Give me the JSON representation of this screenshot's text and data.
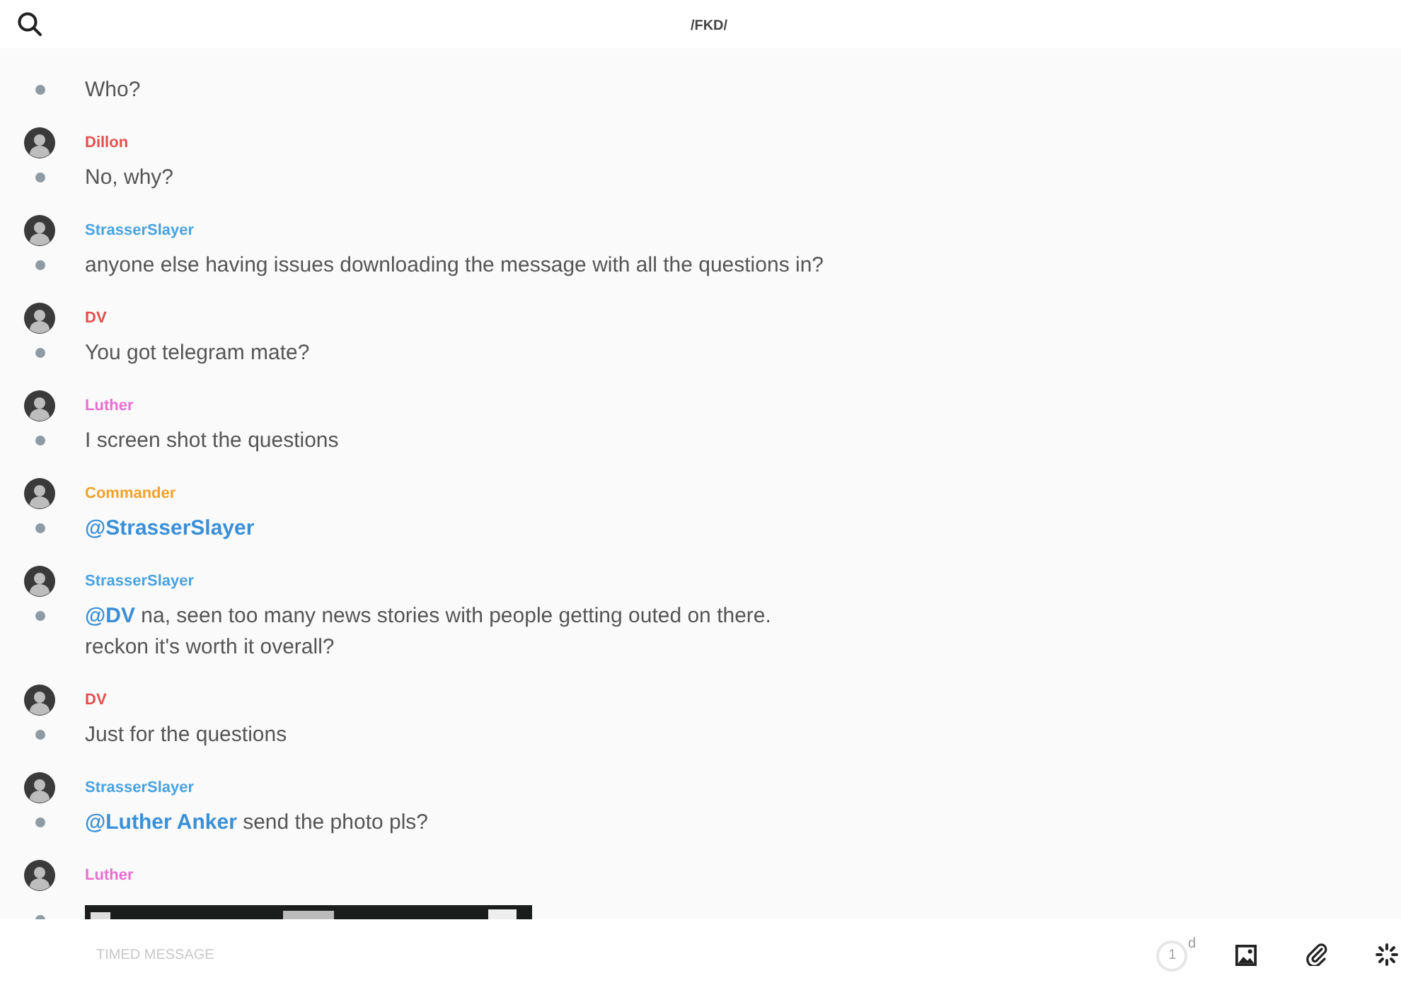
{
  "header": {
    "title": "/FKD/"
  },
  "messages": [
    {
      "lines": [
        {
          "text": "Who?"
        }
      ]
    },
    {
      "author": "Dillon",
      "color": "#e2504c",
      "lines": [
        {
          "text": "No, why?"
        }
      ]
    },
    {
      "author": "StrasserSlayer",
      "color": "#4aa3df",
      "lines": [
        {
          "text": "anyone else having issues downloading the message with all the questions in?"
        }
      ]
    },
    {
      "author": "DV",
      "color": "#e2504c",
      "lines": [
        {
          "text": "You got telegram mate?"
        }
      ]
    },
    {
      "author": "Luther",
      "color": "#e86fd0",
      "lines": [
        {
          "text": "I screen shot the questions"
        }
      ]
    },
    {
      "author": "Commander",
      "color": "#f2a22c",
      "lines": [
        {
          "mention": "@StrasserSlayer"
        }
      ]
    },
    {
      "author": "StrasserSlayer",
      "color": "#4aa3df",
      "lines": [
        {
          "mention": "@DV",
          "text": "na, seen too many news stories with people getting outed on there.\nreckon it's worth it overall?"
        }
      ]
    },
    {
      "author": "DV",
      "color": "#e2504c",
      "lines": [
        {
          "text": "Just for the questions"
        }
      ]
    },
    {
      "author": "StrasserSlayer",
      "color": "#4aa3df",
      "lines": [
        {
          "mention": "@Luther Anker",
          "text": "send the photo pls?"
        }
      ]
    },
    {
      "author": "Luther",
      "color": "#e86fd0"
    }
  ],
  "composer": {
    "placeholder": "TIMED MESSAGE",
    "timer": {
      "count": "1",
      "unit": "d"
    }
  }
}
